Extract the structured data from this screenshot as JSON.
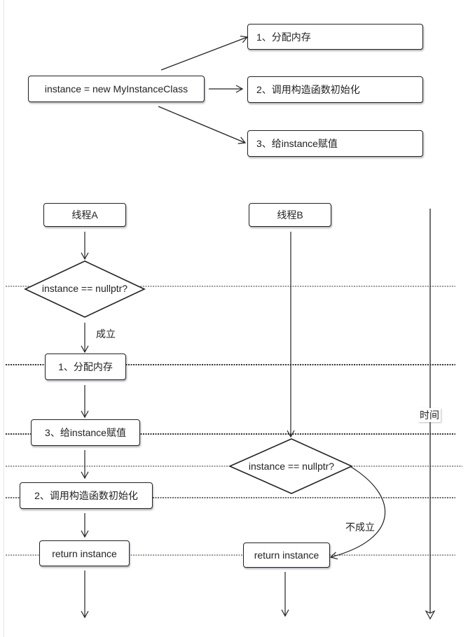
{
  "top": {
    "statement": "instance = new MyInstanceClass",
    "steps": [
      "1、分配内存",
      "2、调用构造函数初始化",
      "3、给instance赋值"
    ]
  },
  "threadA": {
    "title": "线程A",
    "check": "instance == nullptr?",
    "true_label": "成立",
    "step1": "1、分配内存",
    "step3": "3、给instance赋值",
    "step2": "2、调用构造函数初始化",
    "ret": "return instance"
  },
  "threadB": {
    "title": "线程B",
    "check": "instance == nullptr?",
    "false_label": "不成立",
    "ret": "return instance"
  },
  "timeline": {
    "label": "时间"
  }
}
